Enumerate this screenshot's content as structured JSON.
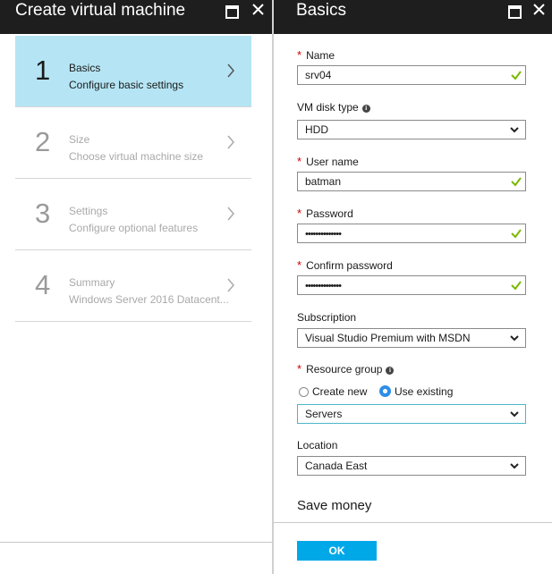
{
  "left_blade": {
    "title": "Create virtual machine",
    "steps": [
      {
        "number": "1",
        "title": "Basics",
        "subtitle": "Configure basic settings",
        "active": true
      },
      {
        "number": "2",
        "title": "Size",
        "subtitle": "Choose virtual machine size",
        "active": false
      },
      {
        "number": "3",
        "title": "Settings",
        "subtitle": "Configure optional features",
        "active": false
      },
      {
        "number": "4",
        "title": "Summary",
        "subtitle": "Windows Server 2016 Datacent...",
        "active": false
      }
    ]
  },
  "right_blade": {
    "title": "Basics",
    "fields": {
      "name": {
        "label": "Name",
        "value": "srv04",
        "required": true
      },
      "vm_disk_type": {
        "label": "VM disk type",
        "value": "HDD"
      },
      "user_name": {
        "label": "User name",
        "value": "batman",
        "required": true
      },
      "password": {
        "label": "Password",
        "value": "••••••••••••••",
        "required": true
      },
      "confirm_password": {
        "label": "Confirm password",
        "value": "••••••••••••••",
        "required": true
      },
      "subscription": {
        "label": "Subscription",
        "value": "Visual Studio Premium with MSDN"
      },
      "resource_group": {
        "label": "Resource group",
        "required": true,
        "options": [
          "Create new",
          "Use existing"
        ],
        "selected_option": "Use existing",
        "value": "Servers"
      },
      "location": {
        "label": "Location",
        "value": "Canada East"
      }
    },
    "section_title": "Save money",
    "ok_label": "OK"
  },
  "icons": {
    "maximize": "maximize-icon",
    "close": "close-icon",
    "chevron_right": "chevron-right-icon",
    "chevron_down": "chevron-down-icon",
    "check": "check-icon",
    "info": "info-icon"
  },
  "colors": {
    "header_bg": "#1e1e1e",
    "active_step_bg": "#b5e5f4",
    "required_star": "#cc0000",
    "check": "#7ab800",
    "ok_button": "#00a8e8",
    "radio_selected": "#2e8ee6",
    "focus_border": "#4ab7c8"
  }
}
